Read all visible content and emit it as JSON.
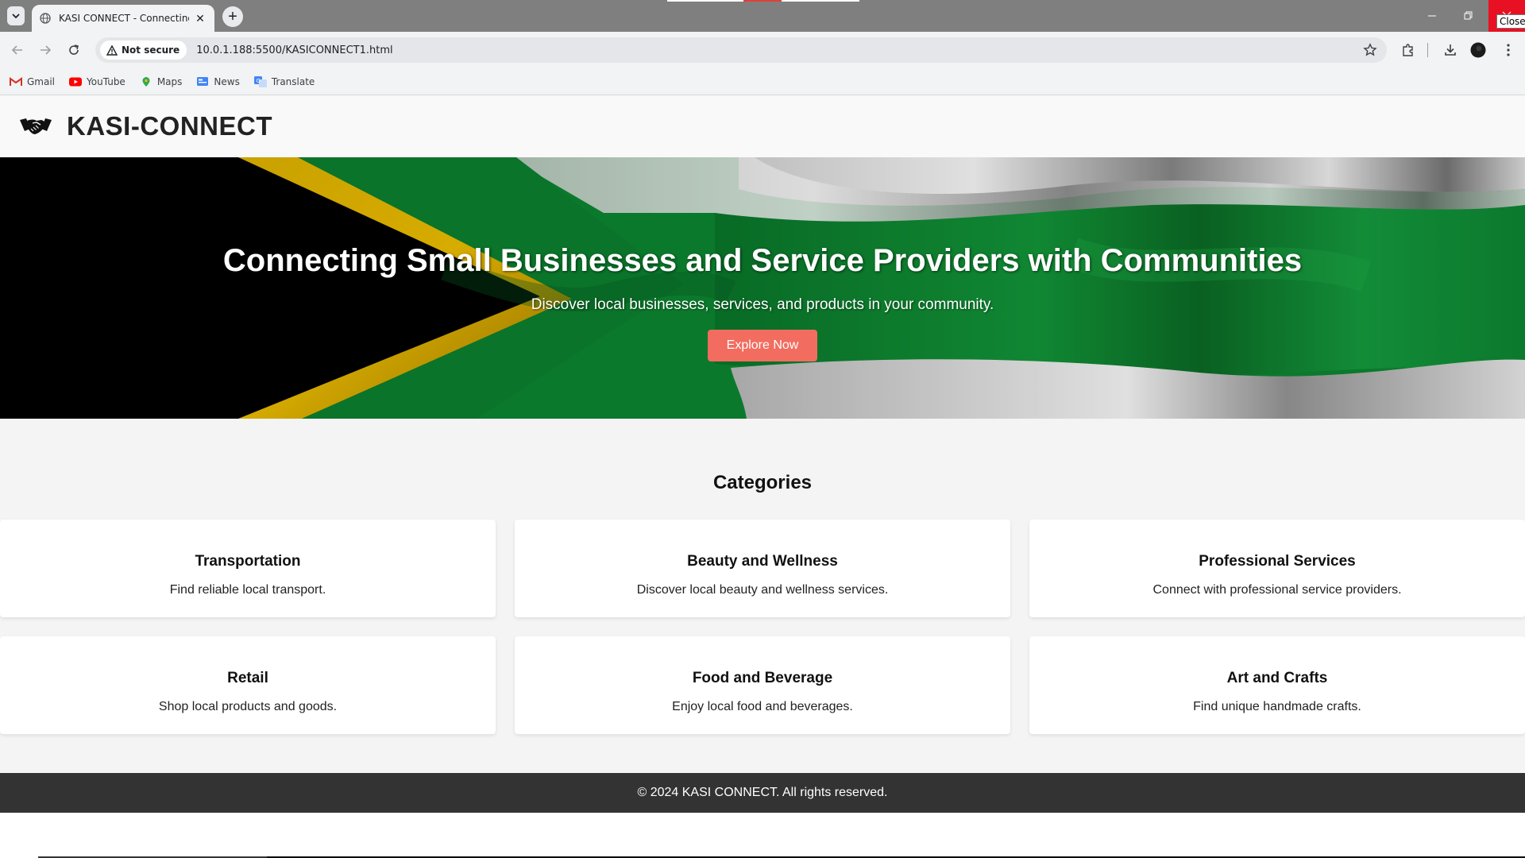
{
  "browser": {
    "tab_title": "KASI CONNECT - Connecting C",
    "security_label": "Not secure",
    "url": "10.0.1.188:5500/KASICONNECT1.html",
    "close_tooltip": "Close",
    "bookmarks": [
      "Gmail",
      "YouTube",
      "Maps",
      "News",
      "Translate"
    ]
  },
  "site": {
    "title": "KASI-CONNECT",
    "logo_icon": "handshake-icon"
  },
  "hero": {
    "title": "Connecting Small Businesses and Service Providers with Communities",
    "subtitle": "Discover local businesses, services, and products in your community.",
    "button_label": "Explore Now",
    "button_color": "#f26c5f"
  },
  "categories": {
    "heading": "Categories",
    "items": [
      {
        "title": "Transportation",
        "description": "Find reliable local transport."
      },
      {
        "title": "Beauty and Wellness",
        "description": "Discover local beauty and wellness services."
      },
      {
        "title": "Professional Services",
        "description": "Connect with professional service providers."
      },
      {
        "title": "Retail",
        "description": "Shop local products and goods."
      },
      {
        "title": "Food and Beverage",
        "description": "Enjoy local food and beverages."
      },
      {
        "title": "Art and Crafts",
        "description": "Find unique handmade crafts."
      }
    ]
  },
  "footer": {
    "text": "© 2024 KASI CONNECT. All rights reserved.",
    "background": "#333333"
  }
}
